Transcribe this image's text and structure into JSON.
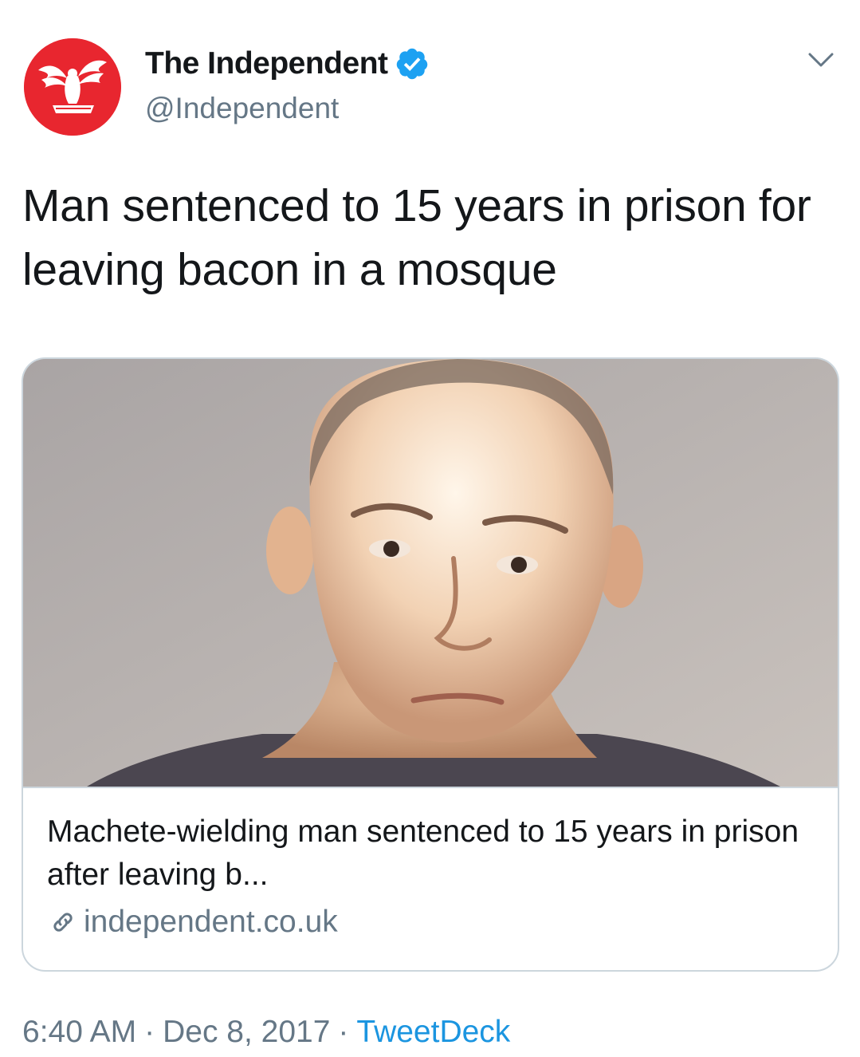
{
  "author": {
    "display_name": "The Independent",
    "handle": "@Independent",
    "verified": true,
    "avatar_icon": "eagle-logo-icon",
    "avatar_color": "#e8262f"
  },
  "tweet": {
    "text": "Man sentenced to 15 years in prison for leaving bacon in a mosque"
  },
  "card": {
    "image_description_icon": "mugshot-photo",
    "title": "Machete-wielding man sentenced to 15 years in prison after leaving b...",
    "domain": "independent.co.uk",
    "link_icon": "link-icon"
  },
  "footer": {
    "time": "6:40 AM",
    "separator": "·",
    "date": "Dec 8, 2017",
    "source": "TweetDeck"
  },
  "colors": {
    "text_primary": "#14171a",
    "text_secondary": "#657786",
    "link_blue": "#1b95e0",
    "verified_blue": "#1da1f2",
    "card_border": "#ccd6dd"
  }
}
